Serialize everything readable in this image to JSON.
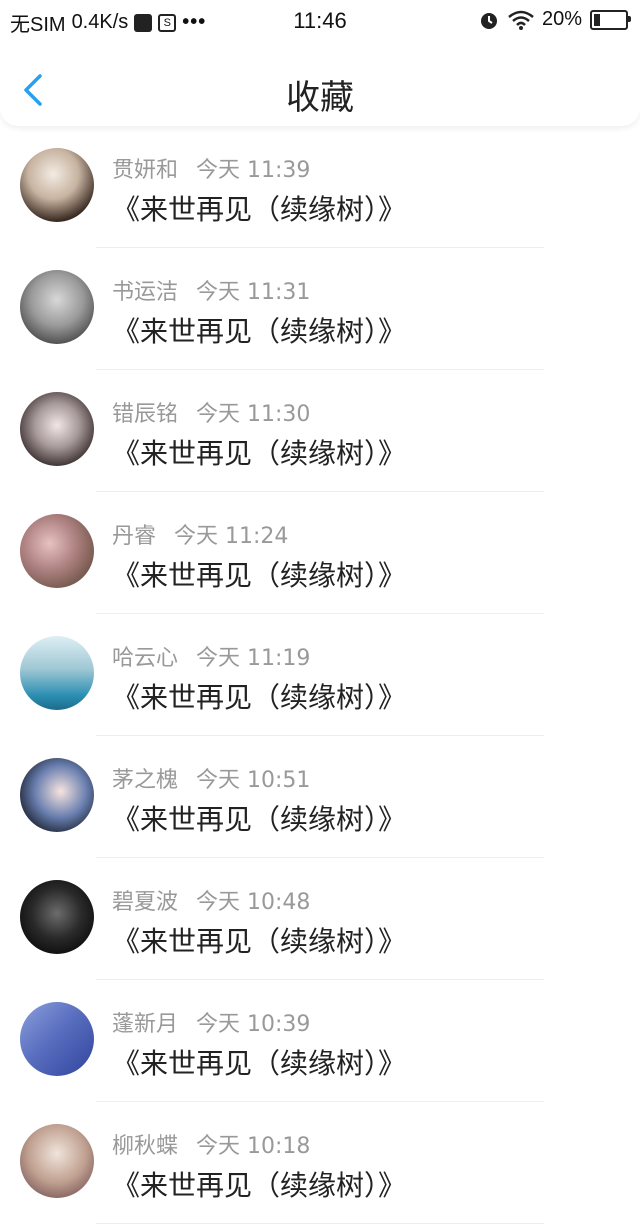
{
  "status_bar": {
    "carrier": "无SIM",
    "speed": "0.4K/s",
    "dots": "•••",
    "time": "11:46",
    "battery_text": "20%",
    "battery_level": 0.2
  },
  "navbar": {
    "title": "收藏",
    "accent": "#2a9ff0"
  },
  "favorites": [
    {
      "name": "贯妍和",
      "time": "今天 11:39",
      "content": "《来世再见（续缘树）》"
    },
    {
      "name": "书运洁",
      "time": "今天 11:31",
      "content": "《来世再见（续缘树）》"
    },
    {
      "name": "错辰铭",
      "time": "今天 11:30",
      "content": "《来世再见（续缘树）》"
    },
    {
      "name": "丹睿",
      "time": "今天 11:24",
      "content": "《来世再见（续缘树）》"
    },
    {
      "name": "哈云心",
      "time": "今天 11:19",
      "content": "《来世再见（续缘树）》"
    },
    {
      "name": "茅之槐",
      "time": "今天 10:51",
      "content": "《来世再见（续缘树）》"
    },
    {
      "name": "碧夏波",
      "time": "今天 10:48",
      "content": "《来世再见（续缘树）》"
    },
    {
      "name": "蓬新月",
      "time": "今天 10:39",
      "content": "《来世再见（续缘树）》"
    },
    {
      "name": "柳秋蝶",
      "time": "今天 10:18",
      "content": "《来世再见（续缘树）》"
    }
  ]
}
